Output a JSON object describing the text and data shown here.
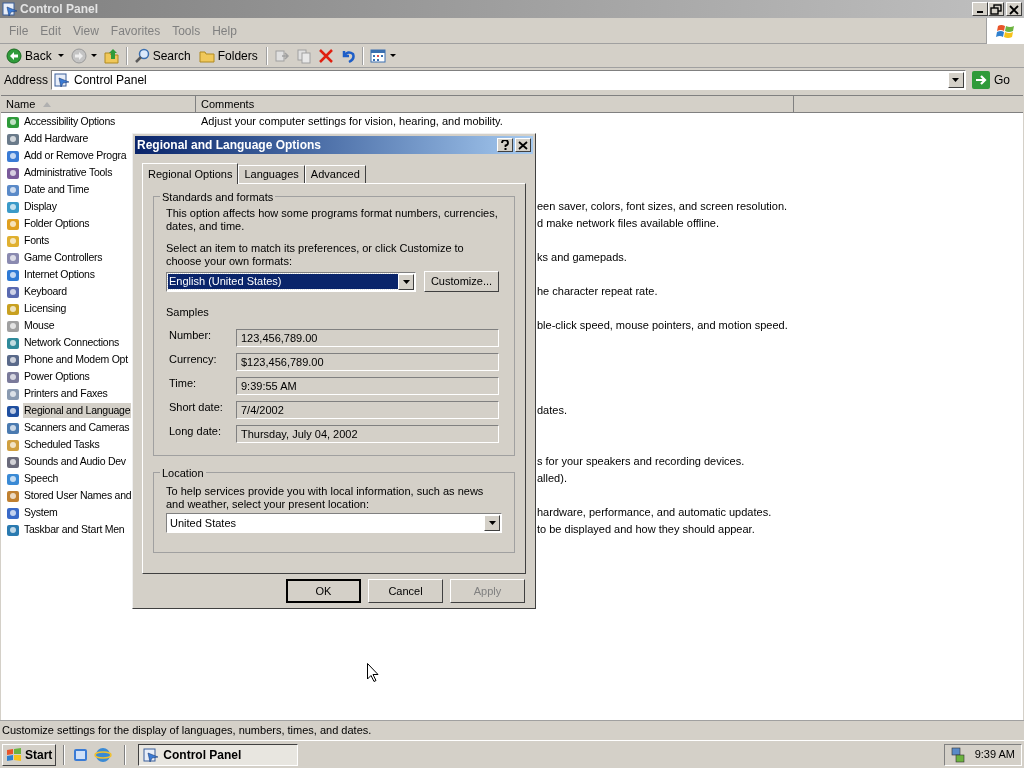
{
  "window": {
    "title": "Control Panel"
  },
  "menu": [
    "File",
    "Edit",
    "View",
    "Favorites",
    "Tools",
    "Help"
  ],
  "toolbar": [
    {
      "kind": "back",
      "label": "Back"
    },
    {
      "kind": "forward"
    },
    {
      "kind": "up"
    },
    {
      "kind": "search",
      "label": "Search"
    },
    {
      "kind": "folders",
      "label": "Folders"
    },
    {
      "kind": "move"
    },
    {
      "kind": "copy"
    },
    {
      "kind": "delete"
    },
    {
      "kind": "undo"
    },
    {
      "kind": "views"
    }
  ],
  "address": {
    "label": "Address",
    "value": "Control Panel",
    "go": "Go"
  },
  "list": {
    "columns": [
      "Name",
      "Comments"
    ],
    "rows": [
      {
        "name": "Accessibility Options",
        "comment": "Adjust your computer settings for vision, hearing, and mobility.",
        "selected": false
      },
      {
        "name": "Add Hardware",
        "selected": false
      },
      {
        "name": "Add or Remove Progra",
        "selected": false
      },
      {
        "name": "Administrative Tools",
        "selected": false
      },
      {
        "name": "Date and Time",
        "selected": false
      },
      {
        "name": "Display",
        "comment": "een saver, colors, font sizes, and screen resolution.",
        "selected": false
      },
      {
        "name": "Folder Options",
        "comment": "d make network files available offline.",
        "selected": false
      },
      {
        "name": "Fonts",
        "selected": false
      },
      {
        "name": "Game Controllers",
        "comment": "ks and gamepads.",
        "selected": false
      },
      {
        "name": "Internet Options",
        "selected": false
      },
      {
        "name": "Keyboard",
        "comment": "he character repeat rate.",
        "selected": false
      },
      {
        "name": "Licensing",
        "selected": false
      },
      {
        "name": "Mouse",
        "comment": "ble-click speed, mouse pointers, and motion speed.",
        "selected": false
      },
      {
        "name": "Network Connections",
        "selected": false
      },
      {
        "name": "Phone and Modem Opt",
        "selected": false
      },
      {
        "name": "Power Options",
        "selected": false
      },
      {
        "name": "Printers and Faxes",
        "selected": false
      },
      {
        "name": "Regional and Language",
        "comment": "dates.",
        "selected": true
      },
      {
        "name": "Scanners and Cameras",
        "selected": false
      },
      {
        "name": "Scheduled Tasks",
        "selected": false
      },
      {
        "name": "Sounds and Audio Dev",
        "comment": "s for your speakers and recording devices.",
        "selected": false
      },
      {
        "name": "Speech",
        "comment": "alled).",
        "selected": false
      },
      {
        "name": "Stored User Names and",
        "selected": false
      },
      {
        "name": "System",
        "comment": "hardware, performance, and automatic updates.",
        "selected": false
      },
      {
        "name": "Taskbar and Start Men",
        "comment": "to be displayed and how they should appear.",
        "selected": false
      }
    ]
  },
  "dialog": {
    "title": "Regional and Language Options",
    "tabs": [
      {
        "label": "Regional Options",
        "selected": true
      },
      {
        "label": "Languages",
        "selected": false
      },
      {
        "label": "Advanced",
        "selected": false
      }
    ],
    "standards": {
      "heading": "Standards and formats",
      "intro": "This option affects how some programs format numbers, currencies, dates, and time.",
      "prompt": "Select an item to match its preferences, or click Customize to choose your own formats:",
      "format": {
        "value": "English (United States)",
        "focused": true
      },
      "customize": "Customize...",
      "samples_heading": "Samples",
      "samples": [
        {
          "label": "Number:",
          "value": "123,456,789.00"
        },
        {
          "label": "Currency:",
          "value": "$123,456,789.00"
        },
        {
          "label": "Time:",
          "value": "9:39:55 AM"
        },
        {
          "label": "Short date:",
          "value": "7/4/2002"
        },
        {
          "label": "Long date:",
          "value": "Thursday, July 04, 2002"
        }
      ]
    },
    "location": {
      "heading": "Location",
      "prompt": "To help services provide you with local information, such as news and weather, select your present location:",
      "value": "United States"
    },
    "buttons": [
      {
        "label": "OK",
        "default": true,
        "disabled": false
      },
      {
        "label": "Cancel",
        "default": false,
        "disabled": false
      },
      {
        "label": "Apply",
        "default": false,
        "disabled": true
      }
    ]
  },
  "status_bar": "Customize settings for the display of languages, numbers, times, and dates.",
  "taskbar": {
    "start": "Start",
    "tasks": [
      {
        "label": "Control Panel"
      }
    ],
    "clock": "9:39 AM"
  }
}
